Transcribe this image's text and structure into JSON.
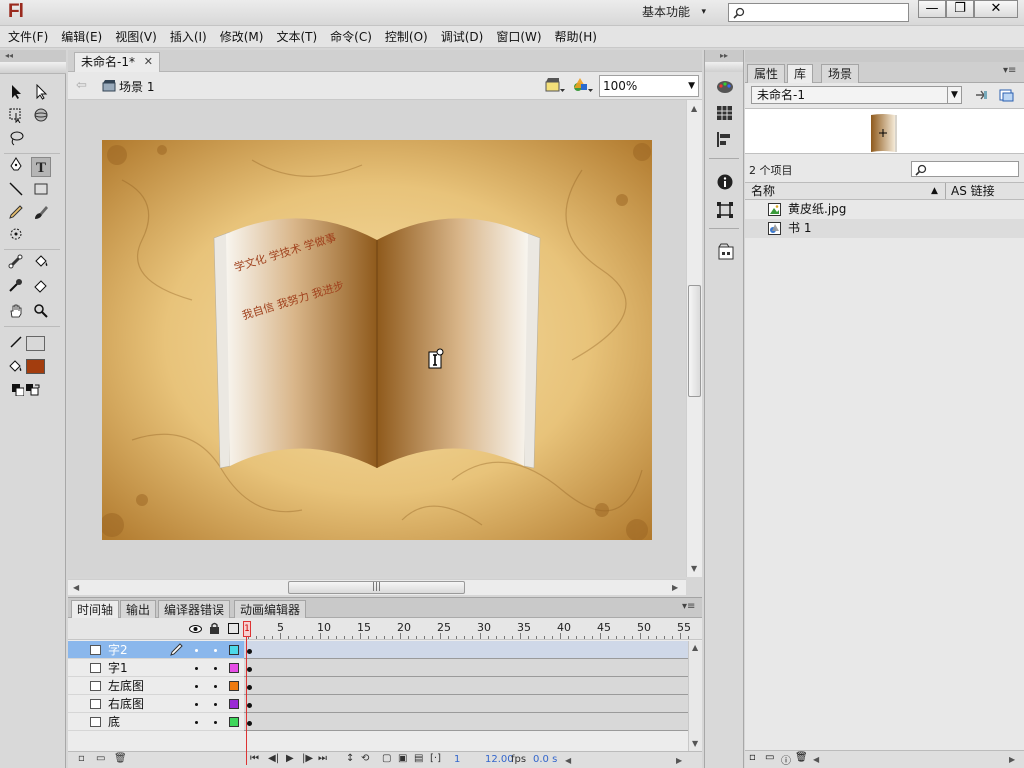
{
  "app": {
    "logo": "Fl",
    "workspace": "基本功能",
    "search_placeholder": "",
    "window_controls": {
      "minimize": "—",
      "maximize": "❐",
      "close": "✕"
    }
  },
  "menu": [
    "文件(F)",
    "编辑(E)",
    "视图(V)",
    "插入(I)",
    "修改(M)",
    "文本(T)",
    "命令(C)",
    "控制(O)",
    "调试(D)",
    "窗口(W)",
    "帮助(H)"
  ],
  "document": {
    "tab_title": "未命名-1*",
    "scene_label": "场景 1",
    "zoom": "100%"
  },
  "stage": {
    "book_text_line1": "学文化 学技术 学做事",
    "book_text_line2": "我自信 我努力 我进步",
    "text_color": "#a0421e"
  },
  "timeline": {
    "tabs": [
      "时间轴",
      "输出",
      "编译器错误",
      "动画编辑器"
    ],
    "frame_numbers": [
      "1",
      "5",
      "10",
      "15",
      "20",
      "25",
      "30",
      "35",
      "40",
      "45",
      "50",
      "55"
    ],
    "layers": [
      {
        "name": "字2",
        "color": "#4dd9e8",
        "selected": true
      },
      {
        "name": "字1",
        "color": "#e64de6",
        "selected": false
      },
      {
        "name": "左底图",
        "color": "#ee7a10",
        "selected": false
      },
      {
        "name": "右底图",
        "color": "#9a2ad6",
        "selected": false
      },
      {
        "name": "底",
        "color": "#3ed65a",
        "selected": false
      }
    ],
    "footer": {
      "frame": "1",
      "fps": "12.00",
      "fps_unit": "fps",
      "time": "0.0 s"
    }
  },
  "library": {
    "tabs": [
      "属性",
      "库",
      "场景"
    ],
    "document_select": "未命名-1",
    "item_count": "2 个项目",
    "col_name": "名称",
    "col_link": "AS 链接",
    "items": [
      {
        "name": "黄皮纸.jpg",
        "icon": "bitmap-icon"
      },
      {
        "name": "书 1",
        "icon": "graphic-symbol-icon"
      }
    ]
  }
}
